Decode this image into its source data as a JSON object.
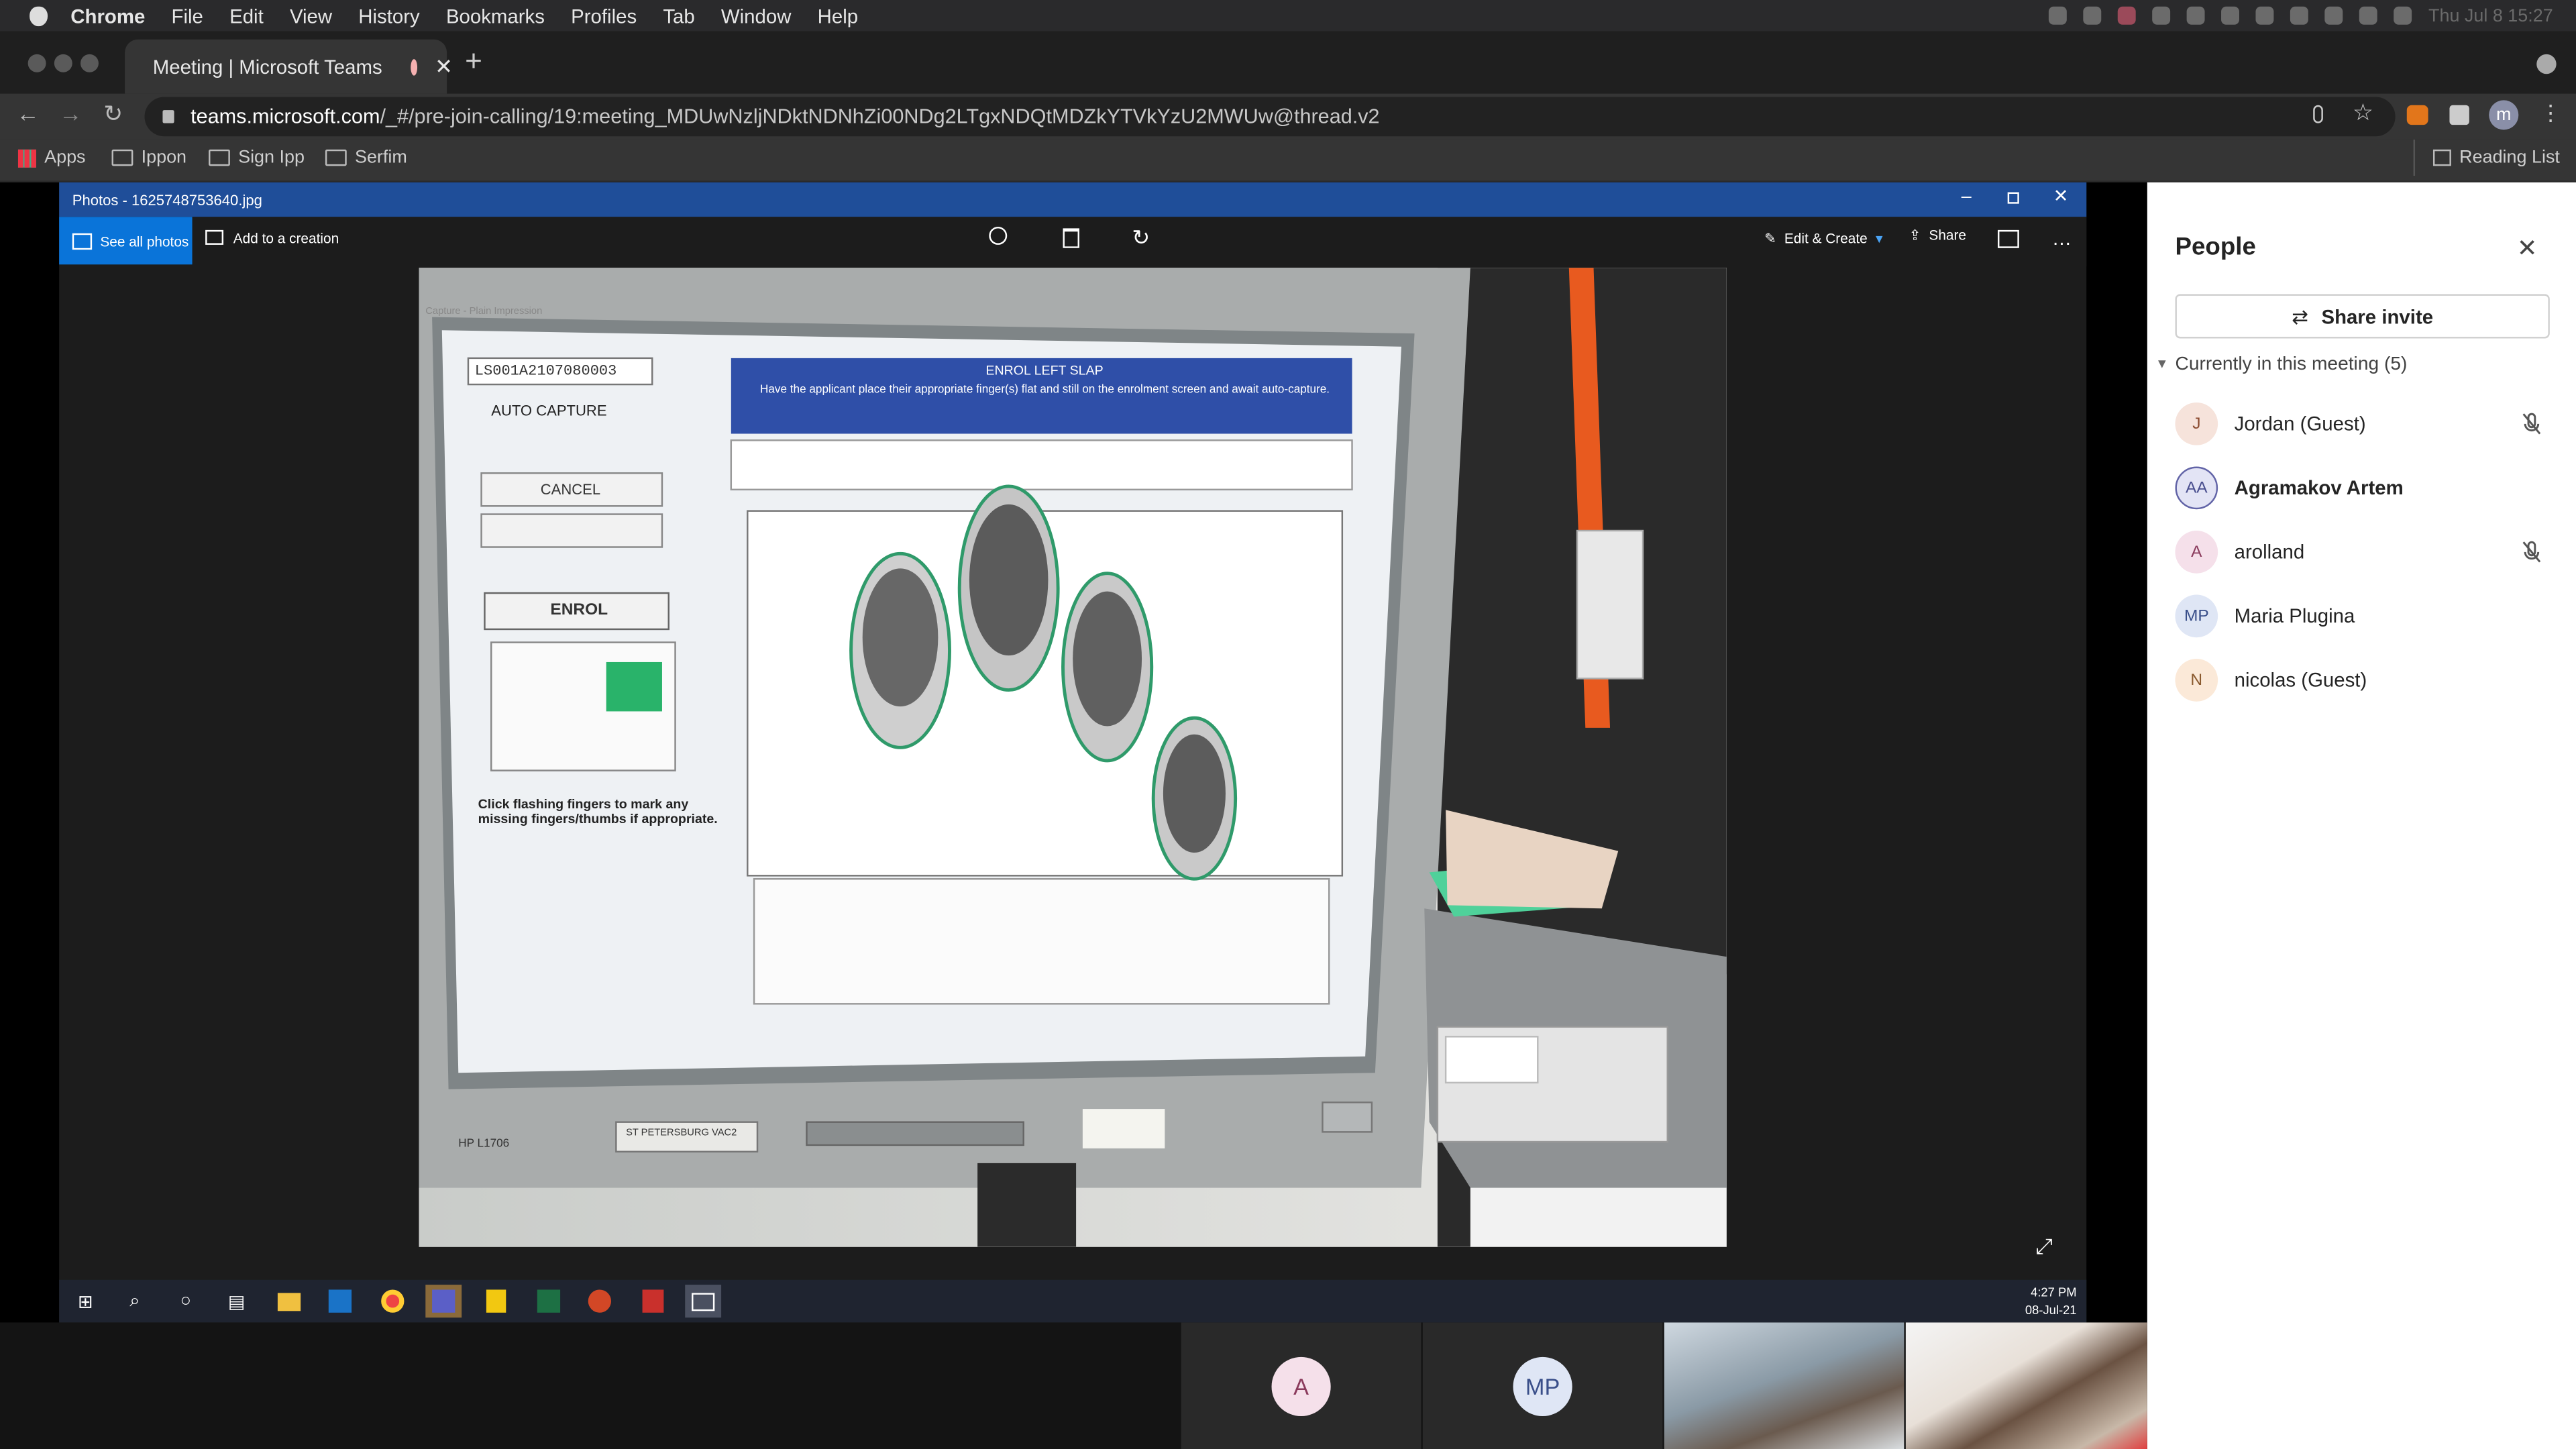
{
  "menubar": {
    "app": "Chrome",
    "items": [
      "File",
      "Edit",
      "View",
      "History",
      "Bookmarks",
      "Profiles",
      "Tab",
      "Window",
      "Help"
    ],
    "clock": "Thu Jul 8  15:27"
  },
  "browser": {
    "tab_title": "Meeting | Microsoft Teams",
    "url_host": "teams.microsoft.com",
    "url_rest": "/_#/pre-join-calling/19:meeting_MDUwNzljNDktNDNhZi00NDg2LTgxNDQtMDZkYTVkYzU2MWUw@thread.v2",
    "profile_initial": "m"
  },
  "bookmarks": {
    "apps": "Apps",
    "items": [
      "Ippon",
      "Sign Ipp",
      "Serfim"
    ],
    "reading_list": "Reading List"
  },
  "photos": {
    "title": "Photos - 1625748753640.jpg",
    "see_all": "See all photos",
    "add_creation": "Add to a creation",
    "edit_create": "Edit & Create",
    "share": "Share"
  },
  "photo_content": {
    "doc_id": "LS001A2107080003",
    "auto_capture": "AUTO CAPTURE",
    "cancel": "CANCEL",
    "enrol": "ENROL",
    "banner_title": "ENROL LEFT SLAP",
    "banner_text": "Have the applicant place their appropriate finger(s) flat and still on the enrolment screen and await auto-capture.",
    "hint": "Click flashing fingers to mark any missing fingers/thumbs if appropriate.",
    "monitor_model": "HP L1706",
    "sticker": "ST PETERSBURG VAC2",
    "window_caption": "Capture - Plain Impression"
  },
  "taskbar": {
    "time": "4:27 PM",
    "date": "08-Jul-21"
  },
  "people": {
    "title": "People",
    "share_invite": "Share invite",
    "section": "Currently in this meeting (5)",
    "list": [
      {
        "initials": "J",
        "name": "Jordan (Guest)",
        "bg": "#f6e3db",
        "fg": "#8a4a2f",
        "muted": true,
        "bold": false
      },
      {
        "initials": "AA",
        "name": "Agramakov Artem",
        "bg": "#e3e4f5",
        "fg": "#4a4f8f",
        "muted": false,
        "bold": true
      },
      {
        "initials": "A",
        "name": "arolland",
        "bg": "#f5e0ea",
        "fg": "#8a3a5c",
        "muted": true,
        "bold": false
      },
      {
        "initials": "MP",
        "name": "Maria Plugina",
        "bg": "#dfe6f5",
        "fg": "#3a4f8a",
        "muted": false,
        "bold": false
      },
      {
        "initials": "N",
        "name": "nicolas (Guest)",
        "bg": "#fbe9d8",
        "fg": "#8a5a2f",
        "muted": false,
        "bold": false
      }
    ]
  },
  "bottom_tiles": [
    {
      "initials": "A"
    },
    {
      "initials": "MP"
    }
  ]
}
